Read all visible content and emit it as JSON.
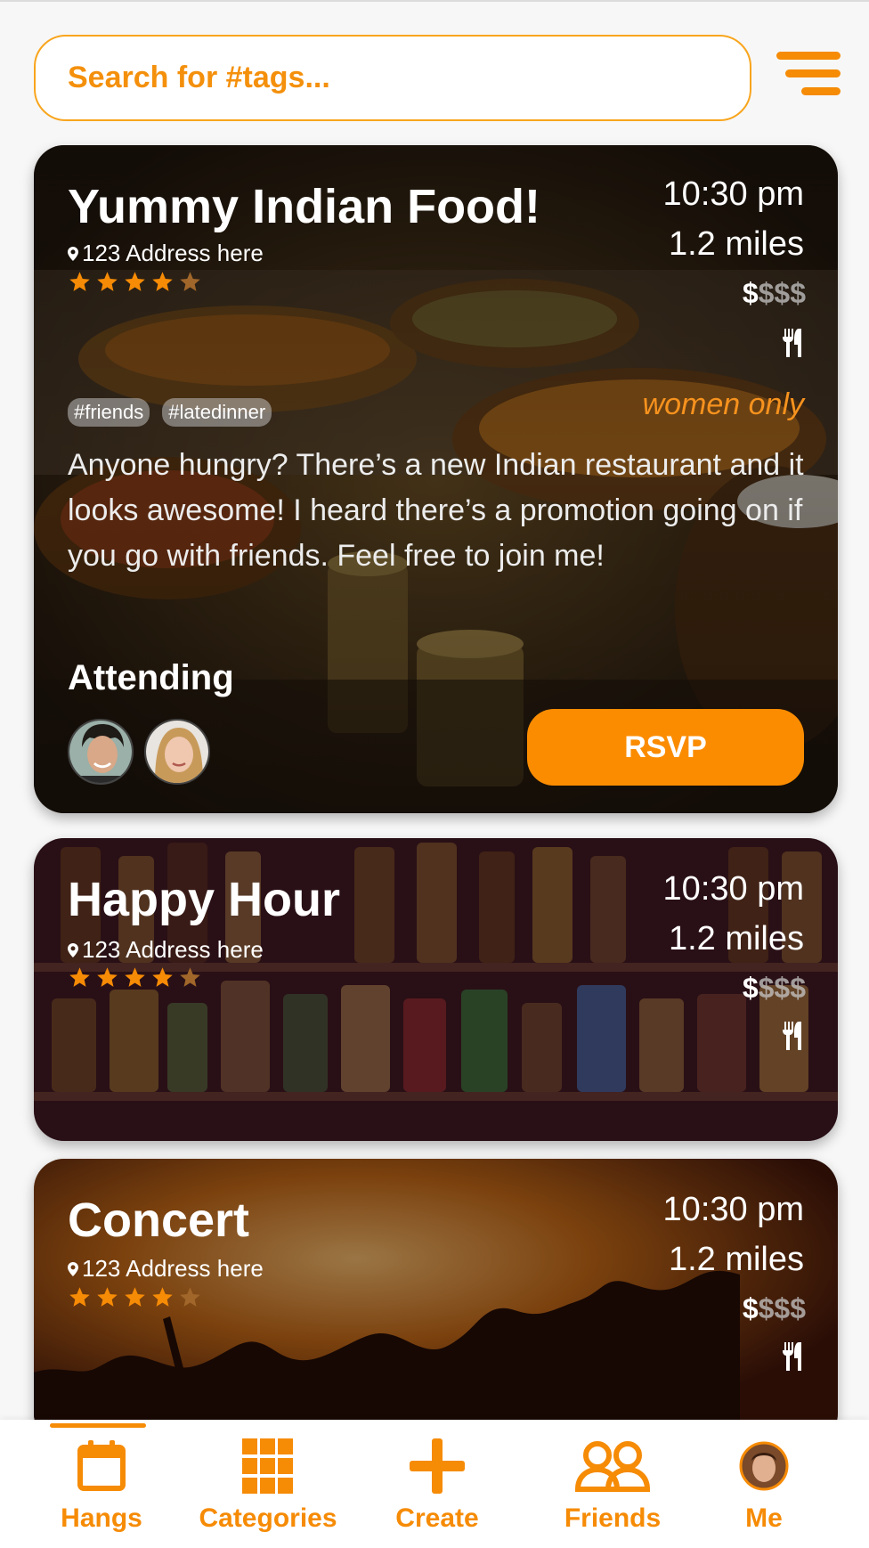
{
  "search": {
    "placeholder": "Search for #tags..."
  },
  "cards": [
    {
      "title": "Yummy Indian Food!",
      "address": "123 Address here",
      "rating": 4,
      "time": "10:30 pm",
      "distance": "1.2 miles",
      "price_on": "$",
      "price_off": "$$$",
      "tags": [
        "#friends",
        "#latedinner"
      ],
      "restriction": "women only",
      "description": "Anyone hungry? There’s a new Indian restaurant and it looks awesome! I heard there’s a promotion going on if you go with friends. Feel free to join me!",
      "attending_label": "Attending",
      "rsvp_label": "RSVP"
    },
    {
      "title": "Happy Hour",
      "address": "123 Address here",
      "rating": 4,
      "time": "10:30 pm",
      "distance": "1.2 miles",
      "price_on": "$",
      "price_off": "$$$"
    },
    {
      "title": "Concert",
      "address": "123 Address here",
      "rating": 4,
      "time": "10:30 pm",
      "distance": "1.2 miles",
      "price_on": "$",
      "price_off": "$$$"
    }
  ],
  "nav": [
    {
      "label": "Hangs",
      "icon": "calendar-icon",
      "active": true
    },
    {
      "label": "Categories",
      "icon": "grid-icon",
      "active": false
    },
    {
      "label": "Create",
      "icon": "plus-icon",
      "active": false
    },
    {
      "label": "Friends",
      "icon": "friends-icon",
      "active": false
    },
    {
      "label": "Me",
      "icon": "avatar",
      "active": false
    }
  ],
  "colors": {
    "accent": "#f68b06",
    "star": "#f68b06",
    "text_light": "#ffffff"
  }
}
